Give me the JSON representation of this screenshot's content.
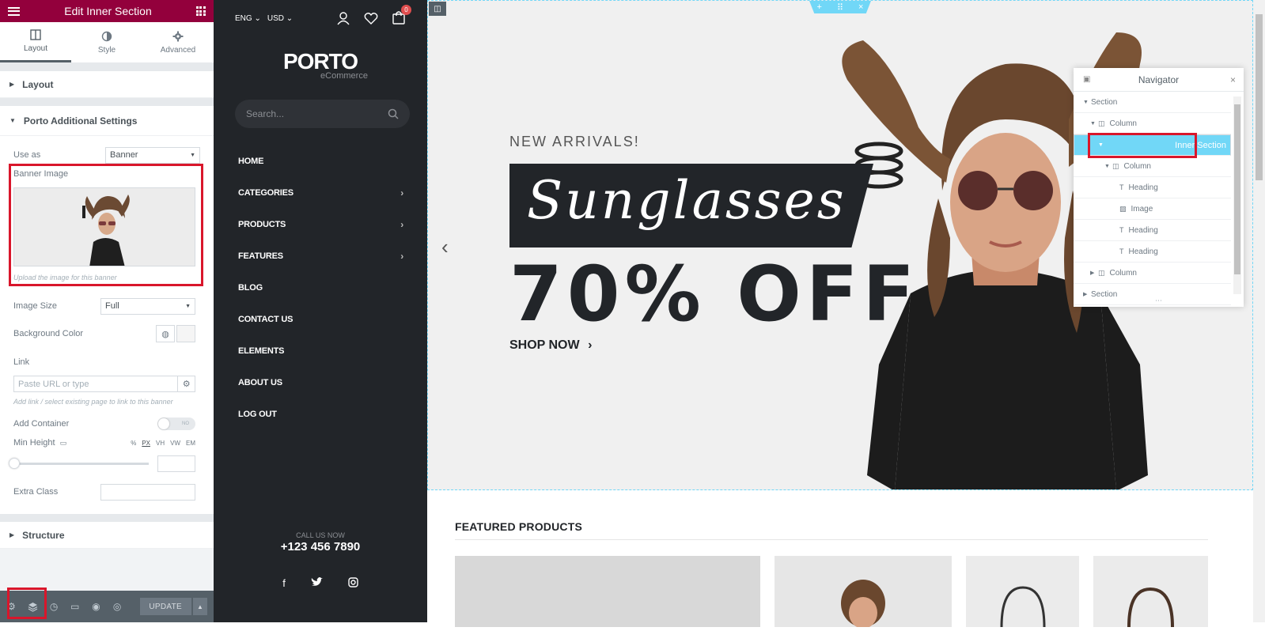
{
  "panel": {
    "title": "Edit Inner Section",
    "tabs": [
      {
        "label": "Layout",
        "icon": "layout-icon"
      },
      {
        "label": "Style",
        "icon": "half-circle-icon"
      },
      {
        "label": "Advanced",
        "icon": "gear-icon"
      }
    ],
    "sections": {
      "layout": "Layout",
      "porto": "Porto Additional Settings",
      "structure": "Structure"
    },
    "controls": {
      "use_as_label": "Use as",
      "use_as_value": "Banner",
      "banner_image_label": "Banner Image",
      "banner_image_help": "Upload the image for this banner",
      "image_size_label": "Image Size",
      "image_size_value": "Full",
      "bg_color_label": "Background Color",
      "link_label": "Link",
      "link_placeholder": "Paste URL or type",
      "link_help": "Add link / select existing page to link to this banner",
      "add_container_label": "Add Container",
      "add_container_toggle": "NO",
      "min_height_label": "Min Height",
      "units": [
        "%",
        "PX",
        "VH",
        "VW",
        "EM"
      ],
      "extra_class_label": "Extra Class"
    },
    "footer": {
      "update_label": "UPDATE"
    }
  },
  "site": {
    "lang": "ENG",
    "currency": "USD",
    "cart_count": "0",
    "logo_main": "PORTO",
    "logo_sub": "eCommerce",
    "search_placeholder": "Search...",
    "menu": [
      {
        "label": "HOME",
        "has_sub": false
      },
      {
        "label": "CATEGORIES",
        "has_sub": true
      },
      {
        "label": "PRODUCTS",
        "has_sub": true
      },
      {
        "label": "FEATURES",
        "has_sub": true
      },
      {
        "label": "BLOG",
        "has_sub": false
      },
      {
        "label": "CONTACT US",
        "has_sub": false
      },
      {
        "label": "ELEMENTS",
        "has_sub": false
      },
      {
        "label": "ABOUT US",
        "has_sub": false
      },
      {
        "label": "LOG OUT",
        "has_sub": false
      }
    ],
    "call_label": "CALL US NOW",
    "phone": "+123 456 7890"
  },
  "hero": {
    "eyebrow": "NEW ARRIVALS!",
    "headline": "Sunglasses",
    "discount": "70% OFF",
    "cta": "SHOP NOW"
  },
  "navigator": {
    "title": "Navigator",
    "items": [
      {
        "label": "Section",
        "depth": 0,
        "twisty": "down",
        "icon": ""
      },
      {
        "label": "Column",
        "depth": 1,
        "twisty": "down",
        "icon": "column-icon"
      },
      {
        "label": "Inner Section",
        "depth": 2,
        "twisty": "down",
        "icon": "",
        "selected": true
      },
      {
        "label": "Column",
        "depth": 3,
        "twisty": "down",
        "icon": "column-icon"
      },
      {
        "label": "Heading",
        "depth": 4,
        "twisty": "",
        "icon": "heading-icon"
      },
      {
        "label": "Image",
        "depth": 4,
        "twisty": "",
        "icon": "image-icon"
      },
      {
        "label": "Heading",
        "depth": 4,
        "twisty": "",
        "icon": "heading-icon"
      },
      {
        "label": "Heading",
        "depth": 4,
        "twisty": "",
        "icon": "heading-icon"
      },
      {
        "label": "Column",
        "depth": 1,
        "twisty": "right",
        "icon": "column-icon"
      },
      {
        "label": "Section",
        "depth": 0,
        "twisty": "right",
        "icon": ""
      }
    ]
  },
  "featured": {
    "title": "FEATURED PRODUCTS"
  },
  "colors": {
    "panel_header": "#93003c",
    "highlight_box": "#d9162b",
    "navigator_selected": "#71d7f7",
    "site_sidebar": "#222529"
  }
}
